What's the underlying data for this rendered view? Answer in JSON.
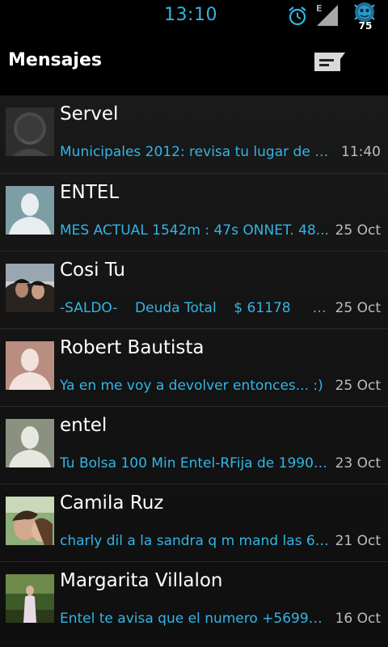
{
  "status_bar": {
    "time": "13:10",
    "network_type": "E",
    "battery_level": "75",
    "icons": [
      "alarm-icon",
      "signal-icon",
      "battery-icon"
    ]
  },
  "action_bar": {
    "title": "Mensajes",
    "compose_icon": "compose-message-icon"
  },
  "colors": {
    "accent": "#33b5e5",
    "background": "#0b0b0b",
    "divider": "#2a2a2a"
  },
  "conversations": [
    {
      "name": "Servel",
      "snippet": "Municipales 2012: revisa tu lugar de vo...",
      "time": "11:40",
      "avatar": "default-contact-icon"
    },
    {
      "name": "ENTEL",
      "snippet": "MES ACTUAL 1542m : 47s ONNET. 48...",
      "time": "25 Oct",
      "avatar": "contact-silhouette-icon"
    },
    {
      "name": "Cosi Tu",
      "snippet": "-SALDO-    Deuda Total    $ 61178       ...",
      "time": "25 Oct",
      "avatar": "contact-photo"
    },
    {
      "name": "Robert Bautista",
      "snippet": "Ya en me voy a devolver entonces... :)",
      "time": "25 Oct",
      "avatar": "contact-silhouette-icon"
    },
    {
      "name": "entel",
      "snippet": "Tu Bolsa 100 Min Entel-RFija de 1990 ...",
      "time": "23 Oct",
      "avatar": "contact-silhouette-icon"
    },
    {
      "name": "Camila Ruz",
      "snippet": "charly dil a la sandra q m mand las 66 ...",
      "time": "21 Oct",
      "avatar": "contact-photo"
    },
    {
      "name": "Margarita Villalon",
      "snippet": "Entel te avisa que el numero +569977...",
      "time": "16 Oct",
      "avatar": "contact-photo"
    }
  ]
}
